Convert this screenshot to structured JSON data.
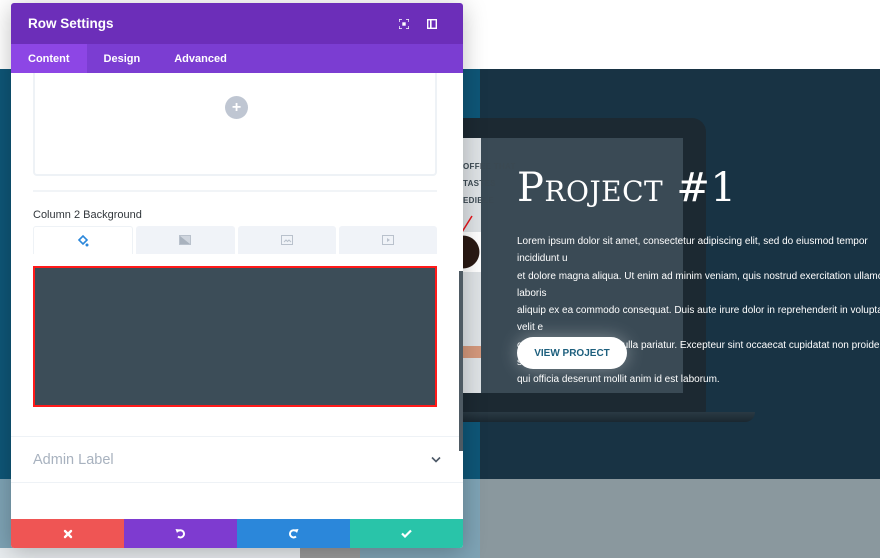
{
  "modal": {
    "title": "Row Settings",
    "header_icons": [
      "fullscreen-icon",
      "split-view-icon"
    ],
    "tabs": [
      {
        "label": "Content",
        "active": true
      },
      {
        "label": "Design",
        "active": false
      },
      {
        "label": "Advanced",
        "active": false
      }
    ],
    "add_module_symbol": "+",
    "column_background": {
      "label": "Column 2 Background",
      "tabs": [
        "color-icon",
        "gradient-icon",
        "image-icon",
        "video-icon"
      ],
      "active_tab": "color-icon",
      "color": "#3c4d58"
    },
    "admin_label": "Admin Label",
    "footer": {
      "cancel": "cancel",
      "undo": "undo",
      "redo": "redo",
      "save": "save"
    }
  },
  "page": {
    "screen_headline": "OFFEE THAT TASTES\nEDIBLE",
    "project_title": "Project #1",
    "project_description": "Lorem ipsum dolor sit amet, consectetur adipiscing elit, sed do eiusmod tempor incididunt u\net dolore magna aliqua. Ut enim ad minim veniam, quis nostrud exercitation ullamco laboris\naliquip ex ea commodo consequat. Duis aute irure dolor in reprehenderit in voluptate velit e\ncillum dolore eu fugiat nulla pariatur. Excepteur sint occaecat cupidatat non proident, sunt i\nqui officia deserunt mollit anim id est laborum.",
    "cta_label": "VIEW PROJECT"
  },
  "colors": {
    "modal_header": "#6c2eb9",
    "modal_tabs": "#7b3dd2",
    "cancel": "#ef5554",
    "undo": "#7e3bd0",
    "redo": "#2b87da",
    "save": "#29c4a9",
    "highlight": "#ff1a1a",
    "hero": "#183344"
  }
}
